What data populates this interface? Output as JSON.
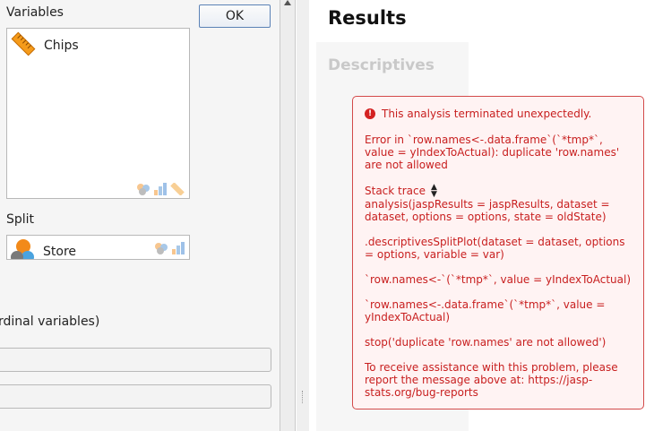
{
  "left_panel": {
    "variables_label": "Variables",
    "variables": [
      {
        "name": "Chips",
        "icon": "scale-ruler-icon"
      }
    ],
    "split_label": "Split",
    "split_variables": [
      {
        "name": "Store",
        "icon": "nominal-circles-icon"
      }
    ],
    "ok_label": "OK",
    "ordinal_text": "rdinal variables)"
  },
  "results": {
    "title": "Results",
    "section_title": "Descriptives",
    "error": {
      "header": "This analysis terminated unexpectedly.",
      "message": "Error in `row.names<-.data.frame`(`*tmp*`,\nvalue = yIndexToActual): duplicate 'row.names'\nare not allowed",
      "stack_trace_label": "Stack trace",
      "trace": [
        "analysis(jaspResults = jaspResults, dataset =\ndataset, options = options, state = oldState)",
        ".descriptivesSplitPlot(dataset = dataset, options\n= options, variable = var)",
        "`row.names<-`(`*tmp*`, value = yIndexToActual)",
        "`row.names<-.data.frame`(`*tmp*`, value =\nyIndexToActual)",
        "stop('duplicate 'row.names' are not allowed')"
      ],
      "assistance": "To receive assistance with this problem, please\nreport the message above at: https://jasp-\nstats.org/bug-reports"
    }
  },
  "colors": {
    "error_red": "#c81f1f",
    "error_border": "#d34a4a",
    "error_bg": "#fff3f3",
    "ok_border": "#5b82b6"
  }
}
